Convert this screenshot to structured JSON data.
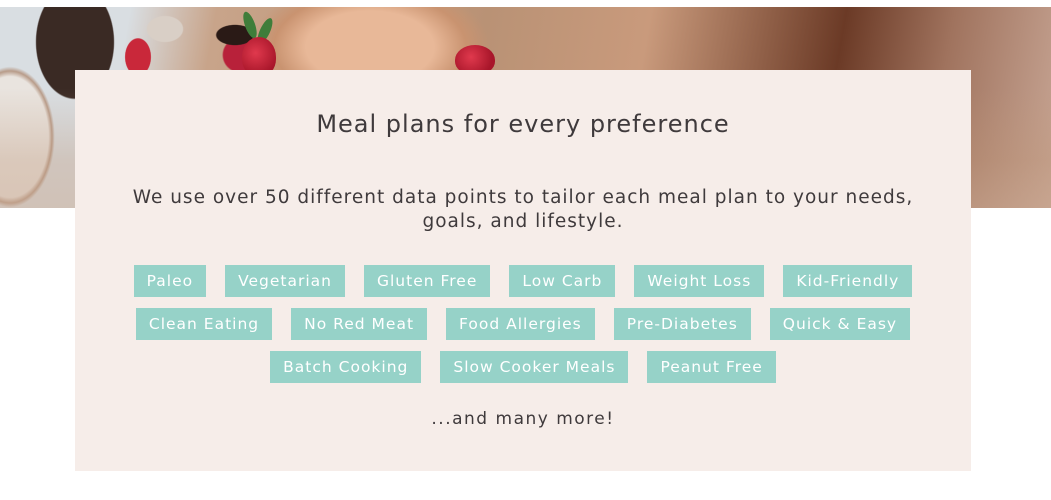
{
  "hero": {
    "image": "food-prep-photo",
    "description": "Hands slicing strawberries on a wooden table"
  },
  "card": {
    "title": "Meal plans for every preference",
    "subtitle": "We use over 50 different data points to tailor each meal plan to your needs, goals, and lifestyle.",
    "tag_rows": [
      [
        "Paleo",
        "Vegetarian",
        "Gluten Free",
        "Low Carb",
        "Weight Loss",
        "Kid-Friendly"
      ],
      [
        "Clean Eating",
        "No Red Meat",
        "Food Allergies",
        "Pre-Diabetes",
        "Quick & Easy"
      ],
      [
        "Batch Cooking",
        "Slow Cooker Meals",
        "Peanut Free"
      ]
    ],
    "more": "...and many more!"
  },
  "colors": {
    "card_background": "#f6ede9",
    "tag_background": "#96d2c8",
    "tag_text": "#ffffff",
    "text": "#3f3a3c"
  }
}
